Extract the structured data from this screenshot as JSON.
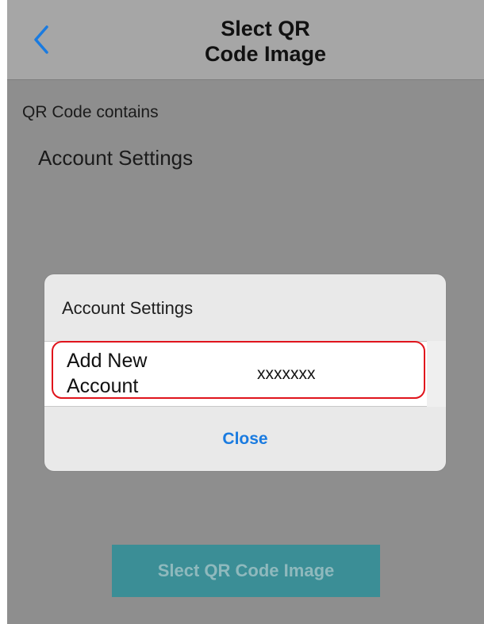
{
  "nav": {
    "title_line1": "Slect QR",
    "title_line2": "Code Image"
  },
  "qr": {
    "label": "QR Code contains",
    "value": "Account Settings"
  },
  "alert": {
    "title": "Account Settings",
    "row_name_line1": "Add New",
    "row_name_line2": "Account",
    "row_value": "xxxxxxx",
    "close_label": "Close"
  },
  "bottom_button_label": "Slect QR Code Image",
  "colors": {
    "accent": "#1a7be0",
    "highlight": "#e0141c",
    "button_bg": "#3b8e96",
    "overlay": "#8e8e8e"
  },
  "icons": {
    "back": "chevron-left-icon"
  }
}
